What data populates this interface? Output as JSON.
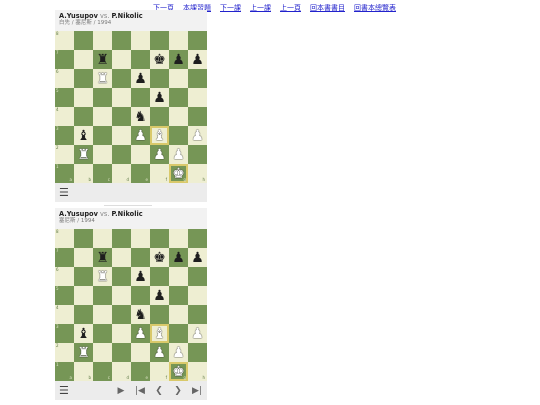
{
  "nav": {
    "links": [
      "下一頁",
      "本課習題",
      "下一課",
      "上一課",
      "上一頁",
      "回本書書目",
      "回書本總覽表"
    ]
  },
  "widget1": {
    "white_player": "A.Yusupov",
    "vs": "vs.",
    "black_player": "P.Nikolic",
    "subtitle": "白先 / 塞尼斯 / 1994",
    "menu_icon": "☰"
  },
  "widget2": {
    "white_player": "A.Yusupov",
    "vs": "vs.",
    "black_player": "P.Nikolic",
    "subtitle": "塞尼斯 / 1994",
    "menu_icon": "☰",
    "controls": [
      "play-icon",
      "first-move-icon",
      "prev-move-icon",
      "next-move-icon",
      "last-move-icon"
    ]
  },
  "board": {
    "ranks": [
      "8",
      "7",
      "6",
      "5",
      "4",
      "3",
      "2",
      "1"
    ],
    "files": [
      "a",
      "b",
      "c",
      "d",
      "e",
      "f",
      "g",
      "h"
    ],
    "rows": [
      [
        "",
        "",
        "",
        "",
        "",
        "",
        "",
        ""
      ],
      [
        "",
        "",
        "r",
        "",
        "",
        "k",
        "p",
        "p"
      ],
      [
        "",
        "",
        "R",
        "",
        "p",
        "",
        "",
        ""
      ],
      [
        "",
        "",
        "",
        "",
        "",
        "p",
        "",
        ""
      ],
      [
        "",
        "",
        "",
        "",
        "n",
        "",
        "",
        ""
      ],
      [
        "",
        "b",
        "",
        "",
        "P",
        "B",
        "",
        "P"
      ],
      [
        "",
        "R",
        "",
        "",
        "",
        "P",
        "P",
        ""
      ],
      [
        "",
        "",
        "",
        "",
        "",
        "",
        "K",
        ""
      ]
    ],
    "highlight": [
      "f3",
      "g1"
    ]
  },
  "colors": {
    "light": "#eeeed2",
    "dark": "#769656",
    "link": "#2222cc"
  }
}
